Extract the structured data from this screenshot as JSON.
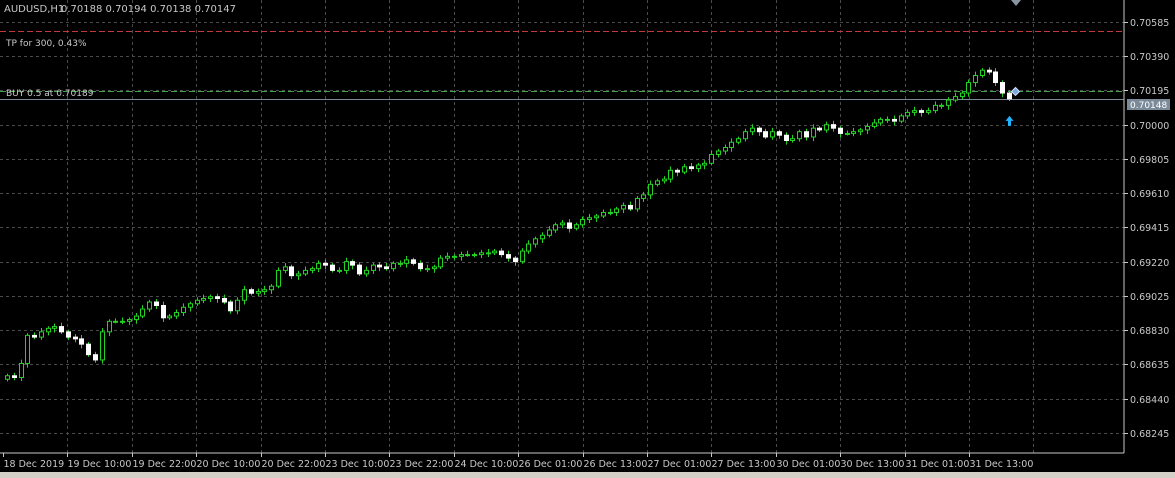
{
  "header": {
    "symbol_timeframe": "AUDUSD,H1",
    "ohlc": "0.70188 0.70194 0.70138 0.70147"
  },
  "levels": {
    "tp": {
      "label": "TP for 300, 0.43%",
      "price": 0.70535,
      "color": "#c23a3a"
    },
    "buy": {
      "label": "BUY 0.5 at 0.70189",
      "price": 0.70189,
      "color": "#3fa64a"
    },
    "bid": {
      "label": "0.70148",
      "price": 0.70148,
      "color": "#7b8a99"
    }
  },
  "colors": {
    "background": "#000000",
    "grid": "#4a4a4a",
    "axis_text": "#c8c8c8",
    "candle": "#22d322",
    "arrow": "#1eb4ff"
  },
  "chart_data": {
    "type": "candlestick",
    "x_tick_labels": [
      "18 Dec 2019",
      "19 Dec 10:00",
      "19 Dec 22:00",
      "20 Dec 10:00",
      "20 Dec 22:00",
      "23 Dec 10:00",
      "23 Dec 22:00",
      "24 Dec 10:00",
      "26 Dec 01:00",
      "26 Dec 13:00",
      "27 Dec 01:00",
      "27 Dec 13:00",
      "30 Dec 01:00",
      "30 Dec 13:00",
      "31 Dec 01:00",
      "31 Dec 13:00"
    ],
    "y_tick_labels": [
      "0.70585",
      "0.70390",
      "0.70195",
      "0.70000",
      "0.69805",
      "0.69610",
      "0.69415",
      "0.69220",
      "0.69025",
      "0.68830",
      "0.68635",
      "0.68440",
      "0.68245"
    ],
    "ylim": [
      0.6813,
      0.7071
    ],
    "grid": true,
    "close": [
      0.6857,
      0.6856,
      0.6864,
      0.688,
      0.6879,
      0.6882,
      0.6884,
      0.6885,
      0.6882,
      0.6879,
      0.6878,
      0.6875,
      0.6869,
      0.6866,
      0.6882,
      0.6888,
      0.6888,
      0.6888,
      0.6889,
      0.6891,
      0.6895,
      0.6899,
      0.6897,
      0.689,
      0.6891,
      0.6893,
      0.6896,
      0.6898,
      0.69,
      0.6901,
      0.6902,
      0.6901,
      0.6899,
      0.6894,
      0.69,
      0.6906,
      0.6904,
      0.6905,
      0.6906,
      0.6908,
      0.6917,
      0.6919,
      0.6914,
      0.6915,
      0.6917,
      0.6918,
      0.6921,
      0.692,
      0.6917,
      0.6917,
      0.6922,
      0.692,
      0.6915,
      0.6917,
      0.692,
      0.6919,
      0.6918,
      0.6921,
      0.6921,
      0.6923,
      0.6921,
      0.6918,
      0.6918,
      0.6919,
      0.6924,
      0.6925,
      0.6925,
      0.6926,
      0.6926,
      0.6926,
      0.6927,
      0.6927,
      0.6928,
      0.6926,
      0.6924,
      0.6922,
      0.6928,
      0.6932,
      0.6935,
      0.6937,
      0.694,
      0.6943,
      0.6944,
      0.6941,
      0.6943,
      0.6946,
      0.6947,
      0.6948,
      0.695,
      0.695,
      0.6952,
      0.6954,
      0.6952,
      0.6958,
      0.696,
      0.6966,
      0.6968,
      0.6969,
      0.6974,
      0.6973,
      0.6976,
      0.6975,
      0.6977,
      0.6978,
      0.6983,
      0.6985,
      0.6987,
      0.699,
      0.6992,
      0.6996,
      0.6998,
      0.6996,
      0.6993,
      0.6996,
      0.6994,
      0.6991,
      0.6992,
      0.6996,
      0.6993,
      0.6998,
      0.6997,
      0.7,
      0.6998,
      0.6995,
      0.6995,
      0.6996,
      0.6997,
      0.6999,
      0.7001,
      0.7003,
      0.7003,
      0.7002,
      0.7005,
      0.7007,
      0.7008,
      0.7007,
      0.7008,
      0.7011,
      0.7011,
      0.7014,
      0.7016,
      0.7018,
      0.7024,
      0.7028,
      0.7031,
      0.703,
      0.7024,
      0.7018,
      0.70147
    ]
  },
  "tooltip": {
    "arrow_icon": "up-arrow-icon",
    "diamond_icon": "trade-marker-icon"
  }
}
